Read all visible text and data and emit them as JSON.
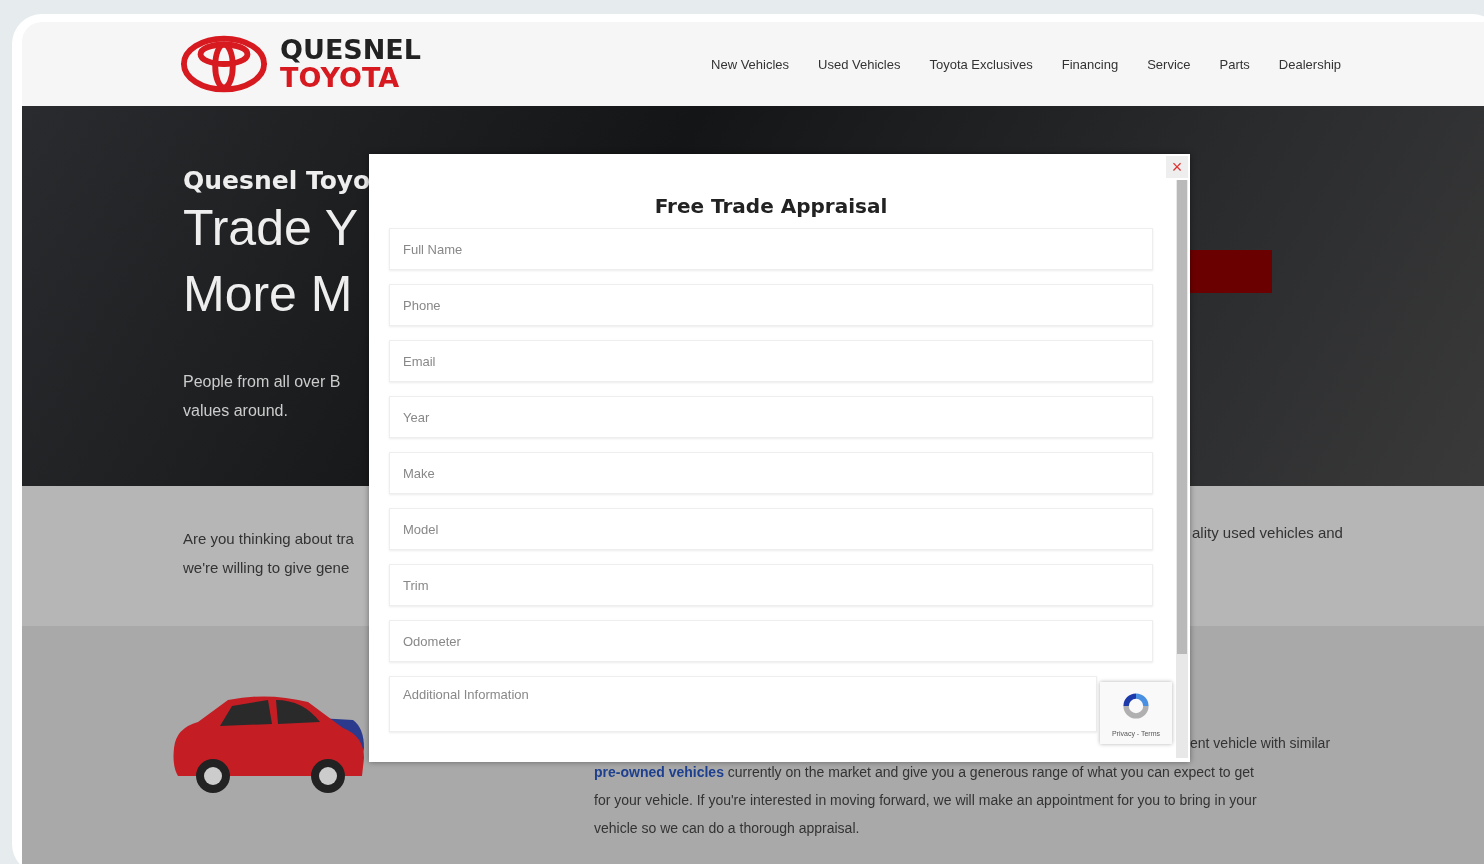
{
  "header": {
    "logo": {
      "line_1": "QUESNEL",
      "line_2": "TOYOTA"
    },
    "nav": [
      {
        "label": "New Vehicles"
      },
      {
        "label": "Used Vehicles"
      },
      {
        "label": "Toyota Exclusives"
      },
      {
        "label": "Financing"
      },
      {
        "label": "Service"
      },
      {
        "label": "Parts"
      },
      {
        "label": "Dealership"
      }
    ]
  },
  "hero": {
    "eyebrow": "Quesnel Toyo",
    "headline": [
      "Trade Y",
      "More M"
    ],
    "lines": [
      "People from all over B",
      "values around."
    ]
  },
  "intro": {
    "left_lines": [
      "Are you thinking about tra",
      "we're willing to give gene"
    ],
    "right_line": "ality used vehicles and"
  },
  "details": {
    "right_line": "ent vehicle with similar",
    "link": "pre-owned vehicles",
    "lines": [
      "currently on the market and give you a generous range of what you can expect to get",
      "for your vehicle. If you're interested in moving forward, we will make an appointment for you to bring in your",
      "vehicle so we can do a thorough appraisal."
    ]
  },
  "modal": {
    "close": "×",
    "title": "Free Trade Appraisal",
    "fields": [
      {
        "kind": "input",
        "placeholder": "Full Name"
      },
      {
        "kind": "input",
        "placeholder": "Phone"
      },
      {
        "kind": "input",
        "placeholder": "Email"
      },
      {
        "kind": "input",
        "placeholder": "Year"
      },
      {
        "kind": "input",
        "placeholder": "Make"
      },
      {
        "kind": "input",
        "placeholder": "Model"
      },
      {
        "kind": "input",
        "placeholder": "Trim"
      },
      {
        "kind": "input",
        "placeholder": "Odometer"
      },
      {
        "kind": "textarea",
        "placeholder": "Additional Information"
      }
    ],
    "captcha": "Privacy - Terms"
  }
}
